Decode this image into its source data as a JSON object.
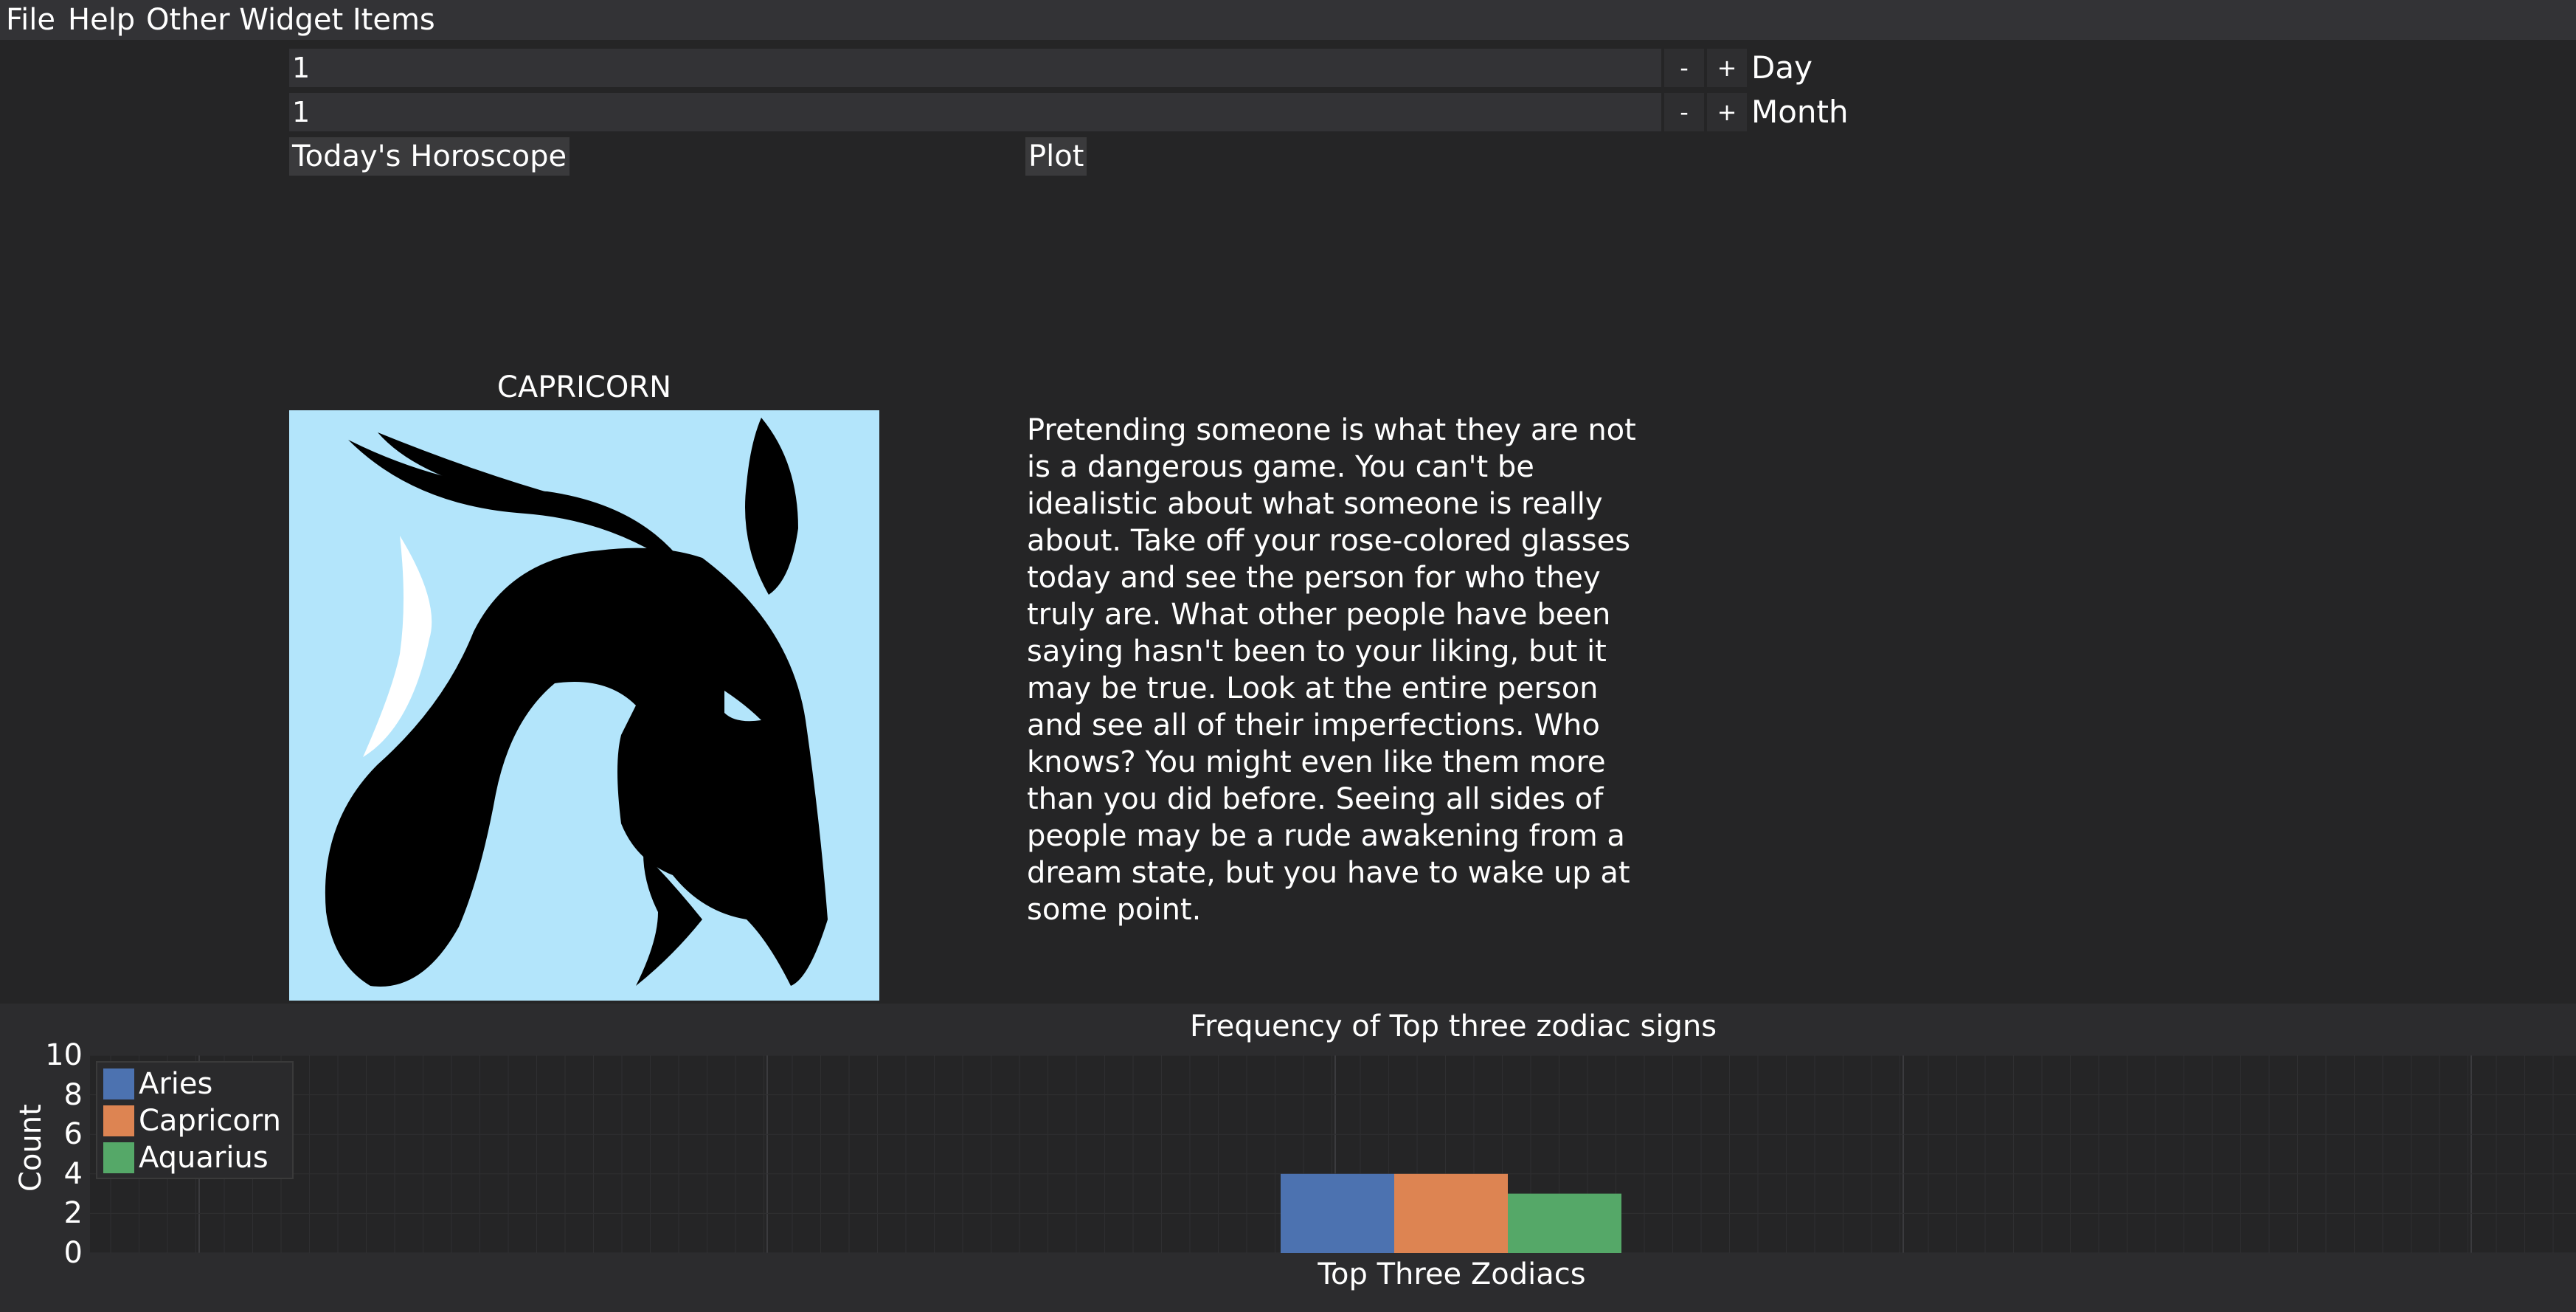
{
  "menu": {
    "file": "File",
    "help": "Help",
    "other": "Other Widget Items"
  },
  "inputs": {
    "day": {
      "value": "1",
      "label": "Day",
      "minus": "-",
      "plus": "+"
    },
    "month": {
      "value": "1",
      "label": "Month",
      "minus": "-",
      "plus": "+"
    }
  },
  "buttons": {
    "horoscope": "Today's Horoscope",
    "plot": "Plot"
  },
  "sign": {
    "name": "CAPRICORN",
    "image_bg": "#b3e5fb"
  },
  "horoscope": {
    "text": "Pretending someone is what they are not is a dangerous game. You can't be idealistic about what someone is really about. Take off your rose-colored glasses today and see the person for who they truly are. What other people have been saying hasn't been to your liking, but it may be true. Look at the entire person and see all of their imperfections. Who knows? You might even like them more than you did before. Seeing all sides of people may be a rude awakening from a dream state, but you have to wake up at some point."
  },
  "chart_data": {
    "type": "bar",
    "title": "Frequency of Top three zodiac signs",
    "xlabel": "Top Three Zodiacs",
    "ylabel": "Count",
    "ylim": [
      0,
      10
    ],
    "yticks": [
      "0",
      "2",
      "4",
      "6",
      "8",
      "10"
    ],
    "grid": true,
    "legend_position": "top-left",
    "series": [
      {
        "name": "Aries",
        "value": 4,
        "color": "#4c72b0"
      },
      {
        "name": "Capricorn",
        "value": 4,
        "color": "#dd8452"
      },
      {
        "name": "Aquarius",
        "value": 3,
        "color": "#55a868"
      }
    ]
  }
}
